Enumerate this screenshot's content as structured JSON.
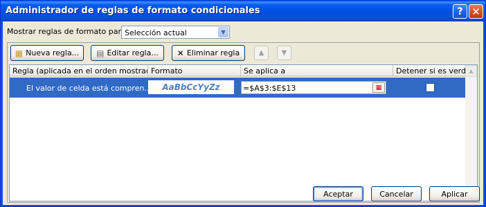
{
  "window": {
    "title": "Administrador de reglas de formato condicionales",
    "help_label": "?",
    "close_label": "✕"
  },
  "show_rules": {
    "label": "Mostrar reglas de formato para:",
    "value": "Selección actual"
  },
  "toolbar": {
    "new_rule": "Nueva regla...",
    "edit_rule": "Editar regla...",
    "delete_rule": "Eliminar regla"
  },
  "table": {
    "headers": {
      "rule": "Regla (aplicada en el orden mostrado)",
      "format": "Formato",
      "applies_to": "Se aplica a",
      "stop_if_true": "Detener si es verdad"
    },
    "rows": [
      {
        "rule": "El valor de celda está compren...",
        "format_preview": "AaBbCcYyZz",
        "applies_to": "=$A$3:$E$13",
        "stop_if_true": false
      }
    ]
  },
  "footer": {
    "ok": "Aceptar",
    "cancel": "Cancelar",
    "apply": "Aplicar"
  },
  "colors": {
    "title_bar": "#0a50e0",
    "selection": "#316ac5",
    "format_preview_text": "#4f81bd"
  }
}
